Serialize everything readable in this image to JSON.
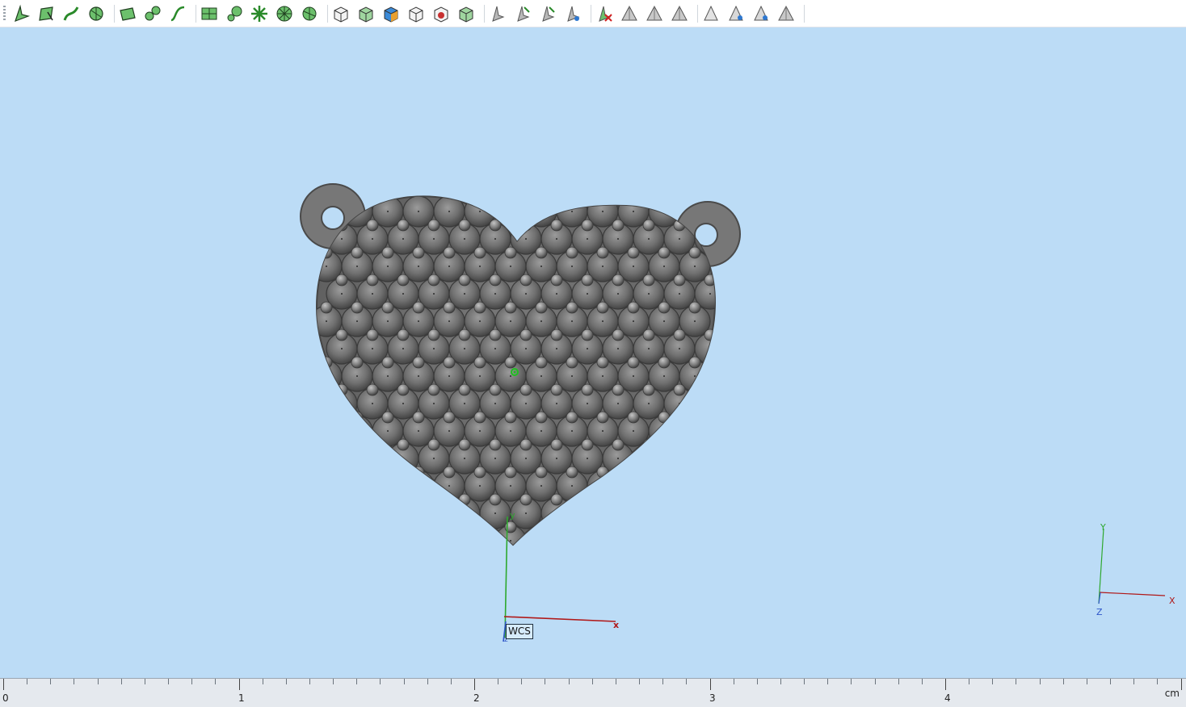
{
  "toolbar": {
    "groups": [
      [
        "select-tool-icon",
        "select-face-icon",
        "select-curve-icon",
        "select-loop-icon"
      ],
      [
        "plane-icon",
        "feature-chain-icon",
        "curve-path-icon"
      ],
      [
        "surface-mesh-icon",
        "gem-setting-icon",
        "snowflake-pattern-icon",
        "radial-array-icon",
        "radial-cut-icon"
      ],
      [
        "cube-front-icon",
        "cube-top-icon",
        "cube-color-icon",
        "cube-wire-icon",
        "cube-red-icon",
        "cube-green-icon"
      ],
      [
        "arrow-cursor-icon",
        "arrow-move-icon",
        "arrow-rotate-icon",
        "arrow-snap-icon"
      ],
      [
        "delete-node-icon",
        "pyramid-icon",
        "pyramid-copy-icon",
        "pyramid-slant-icon"
      ],
      [
        "cone-icon",
        "cone-grid-icon",
        "cone-eye-icon",
        "cone-hatch-icon"
      ]
    ]
  },
  "viewport": {
    "background": "#bcdcf6",
    "model_color": "#6e6e6e",
    "wcs_label": "WCS",
    "wcs_axes": {
      "x": "x",
      "y": "y",
      "z": "z"
    },
    "view_axes": {
      "x": "X",
      "y": "Y",
      "z": "Z"
    },
    "axis_colors": {
      "x": "#b01818",
      "y": "#2ea82e",
      "z": "#2e55c8"
    }
  },
  "ruler": {
    "labels": [
      "0",
      "1",
      "2",
      "3",
      "4"
    ],
    "unit": "cm"
  }
}
